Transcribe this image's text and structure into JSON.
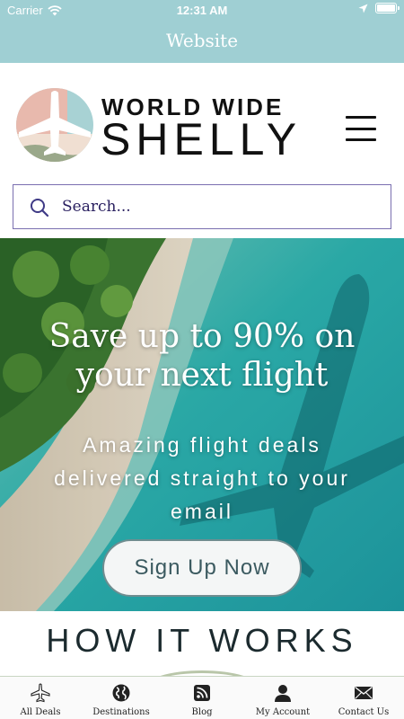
{
  "status_bar": {
    "carrier": "Carrier",
    "time": "12:31 AM"
  },
  "nav": {
    "title": "Website"
  },
  "logo": {
    "line1": "WORLD WIDE",
    "line2": "SHELLY"
  },
  "search": {
    "placeholder": "Search..."
  },
  "hero": {
    "title": "Save up to 90% on your next flight",
    "subtitle": "Amazing flight deals delivered straight to your email",
    "cta_label": "Sign Up Now"
  },
  "section": {
    "heading": "HOW IT WORKS"
  },
  "tabs": [
    {
      "label": "All Deals",
      "icon": "airplane-icon"
    },
    {
      "label": "Destinations",
      "icon": "globe-icon"
    },
    {
      "label": "Blog",
      "icon": "rss-icon"
    },
    {
      "label": "My Account",
      "icon": "person-icon"
    },
    {
      "label": "Contact Us",
      "icon": "envelope-icon"
    }
  ],
  "colors": {
    "nav_bar": "#9fcfd3",
    "search_border": "#7a6fb0",
    "cta_text": "#3b5a60",
    "ocean": "#2bb3b5"
  }
}
